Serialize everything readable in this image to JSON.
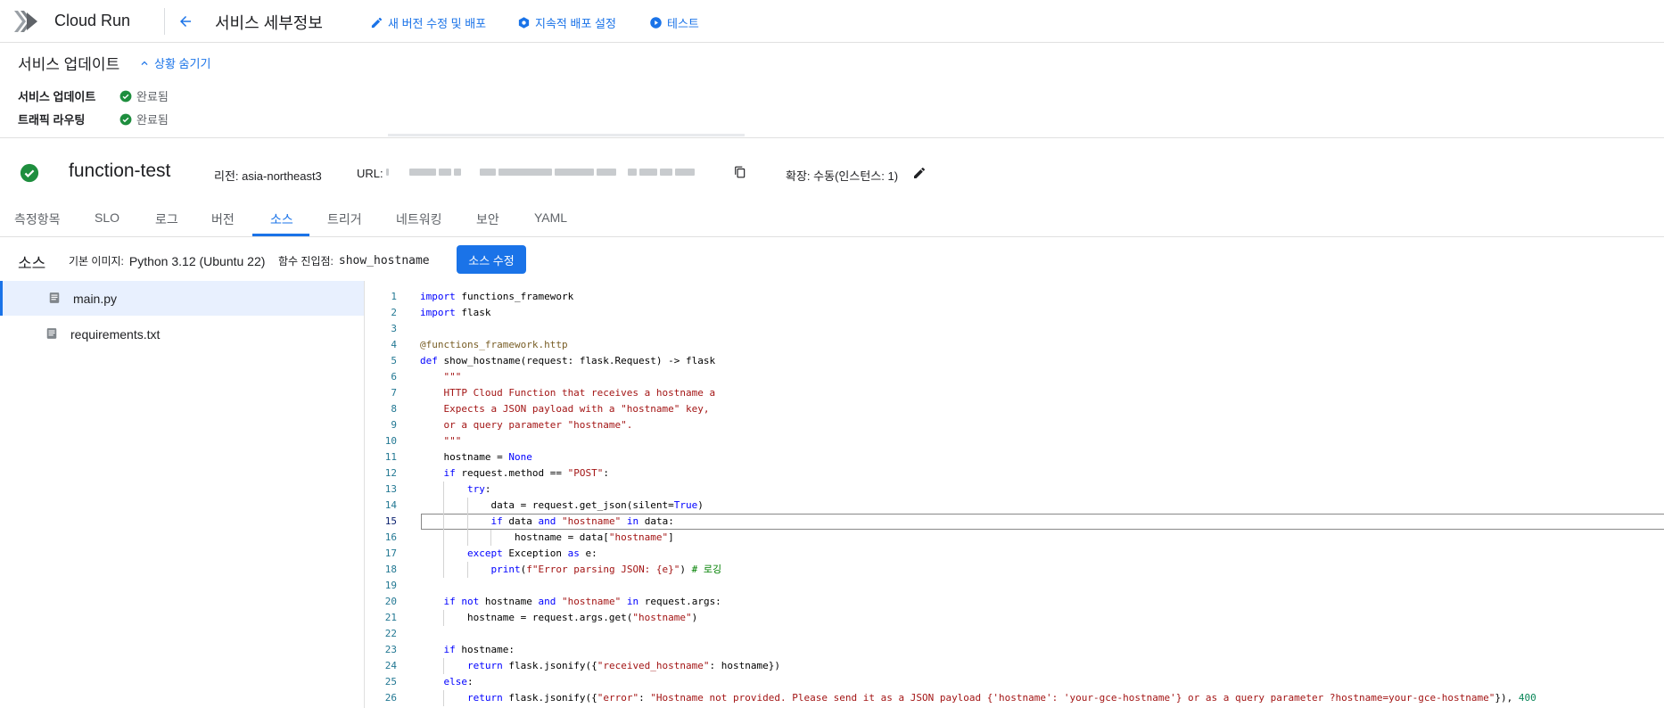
{
  "header": {
    "product_name": "Cloud Run",
    "page_title": "서비스 세부정보",
    "actions": [
      {
        "label": "새 버전 수정 및 배포",
        "icon": "pencil-icon"
      },
      {
        "label": "지속적 배포 설정",
        "icon": "gear-icon"
      },
      {
        "label": "테스트",
        "icon": "play-icon"
      }
    ]
  },
  "status": {
    "title": "서비스 업데이트",
    "hide_label": "상황 숨기기",
    "rows": [
      {
        "label": "서비스 업데이트",
        "value": "완료됨"
      },
      {
        "label": "트래픽 라우팅",
        "value": "완료됨"
      }
    ]
  },
  "service": {
    "name": "function-test",
    "region_label": "리전:",
    "region": "asia-northeast3",
    "url_label": "URL:",
    "scaling_label": "확장:",
    "scaling": "수동(인스턴스: 1)"
  },
  "tabs": [
    "측정항목",
    "SLO",
    "로그",
    "버전",
    "소스",
    "트리거",
    "네트워킹",
    "보안",
    "YAML"
  ],
  "active_tab": "소스",
  "source": {
    "title": "소스",
    "base_image_label": "기본 이미지:",
    "base_image": "Python 3.12 (Ubuntu 22)",
    "entry_label": "함수 진입점:",
    "entry_point": "show_hostname",
    "edit_button": "소스 수정"
  },
  "files": [
    "main.py",
    "requirements.txt"
  ],
  "selected_file": "main.py",
  "current_line": 15,
  "code_lines": [
    {
      "n": "1",
      "t": "import functions_framework"
    },
    {
      "n": "2",
      "t": "import flask"
    },
    {
      "n": "3",
      "t": ""
    },
    {
      "n": "4",
      "t": "@functions_framework.http"
    },
    {
      "n": "5",
      "t": "def show_hostname(request: flask.Request) -> flask"
    },
    {
      "n": "6",
      "t": "    \"\"\""
    },
    {
      "n": "7",
      "t": "    HTTP Cloud Function that receives a hostname a"
    },
    {
      "n": "8",
      "t": "    Expects a JSON payload with a \"hostname\" key,"
    },
    {
      "n": "9",
      "t": "    or a query parameter \"hostname\"."
    },
    {
      "n": "10",
      "t": "    \"\"\""
    },
    {
      "n": "11",
      "t": "    hostname = None"
    },
    {
      "n": "12",
      "t": "    if request.method == \"POST\":"
    },
    {
      "n": "13",
      "t": "        try:"
    },
    {
      "n": "14",
      "t": "            data = request.get_json(silent=True)"
    },
    {
      "n": "15",
      "t": "            if data and \"hostname\" in data:"
    },
    {
      "n": "16",
      "t": "                hostname = data[\"hostname\"]"
    },
    {
      "n": "17",
      "t": "        except Exception as e:"
    },
    {
      "n": "18",
      "t": "            print(f\"Error parsing JSON: {e}\") # 로깅"
    },
    {
      "n": "19",
      "t": ""
    },
    {
      "n": "20",
      "t": "    if not hostname and \"hostname\" in request.args:"
    },
    {
      "n": "21",
      "t": "        hostname = request.args.get(\"hostname\")"
    },
    {
      "n": "22",
      "t": ""
    },
    {
      "n": "23",
      "t": "    if hostname:"
    },
    {
      "n": "24",
      "t": "        return flask.jsonify({\"received_hostname\": hostname})"
    },
    {
      "n": "25",
      "t": "    else:"
    },
    {
      "n": "26",
      "t": "        return flask.jsonify({\"error\": \"Hostname not provided. Please send it as a JSON payload {'hostname': 'your-gce-hostname'} or as a query parameter ?hostname=your-gce-hostname\"}), 400"
    }
  ],
  "colors": {
    "accent": "#1a73e8",
    "success": "#1e8e3e",
    "keyword": "#0000ff",
    "string": "#a31515",
    "comment": "#008000",
    "number": "#098658",
    "line_number": "#237893"
  }
}
